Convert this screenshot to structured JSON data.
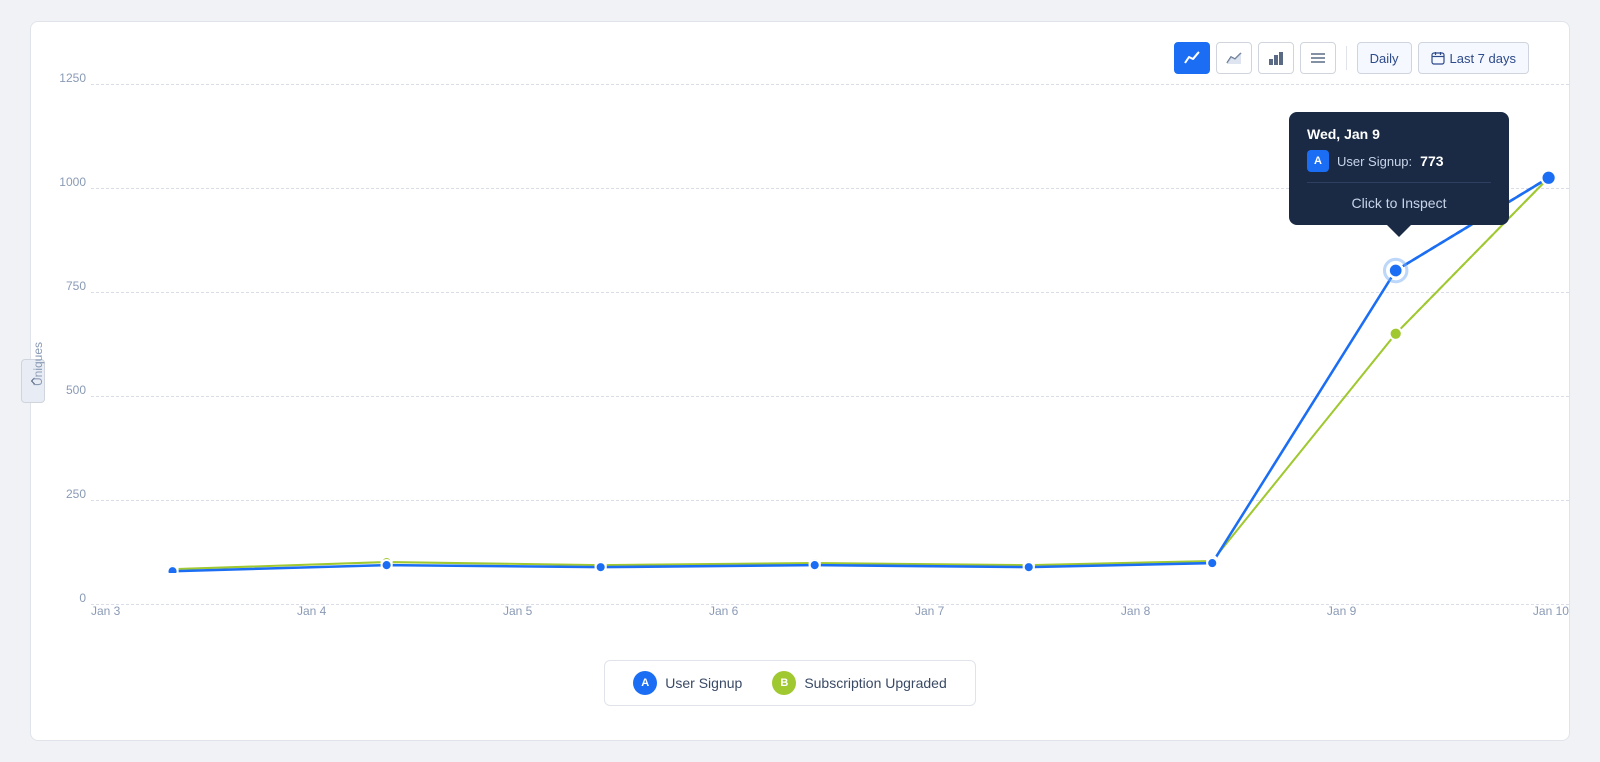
{
  "toolbar": {
    "buttons": [
      {
        "id": "line-chart",
        "label": "~",
        "active": true,
        "icon": "📈"
      },
      {
        "id": "area-chart",
        "label": "area",
        "active": false
      },
      {
        "id": "bar-chart",
        "label": "bar",
        "active": false
      },
      {
        "id": "table",
        "label": "table",
        "active": false
      }
    ],
    "period_label": "Daily",
    "range_label": "Last 7 days",
    "calendar_icon": "📅"
  },
  "chart": {
    "y_axis_label": "Uniques",
    "y_ticks": [
      {
        "value": 1250,
        "label": "1250"
      },
      {
        "value": 1000,
        "label": "1000"
      },
      {
        "value": 750,
        "label": "750"
      },
      {
        "value": 500,
        "label": "500"
      },
      {
        "value": 250,
        "label": "250"
      },
      {
        "value": 0,
        "label": "0"
      }
    ],
    "x_labels": [
      "Jan 3",
      "Jan 4",
      "Jan 5",
      "Jan 6",
      "Jan 7",
      "Jan 8",
      "Jan 9",
      "Jan 10"
    ],
    "series_a": {
      "name": "User Signup",
      "color": "#1b6ef3",
      "data": [
        5,
        20,
        15,
        20,
        15,
        25,
        773,
        1010
      ]
    },
    "series_b": {
      "name": "Subscription Upgraded",
      "color": "#a0c830",
      "data": [
        10,
        28,
        22,
        25,
        20,
        30,
        610,
        1010
      ]
    }
  },
  "tooltip": {
    "date": "Wed, Jan 9",
    "badge_label": "A",
    "event_label": "User Signup:",
    "event_value": "773",
    "inspect_text": "Click to Inspect"
  },
  "legend": {
    "items": [
      {
        "badge": "A",
        "label": "User Signup",
        "class": "a"
      },
      {
        "badge": "B",
        "label": "Subscription Upgraded",
        "class": "b"
      }
    ]
  },
  "side_arrow": "‹"
}
